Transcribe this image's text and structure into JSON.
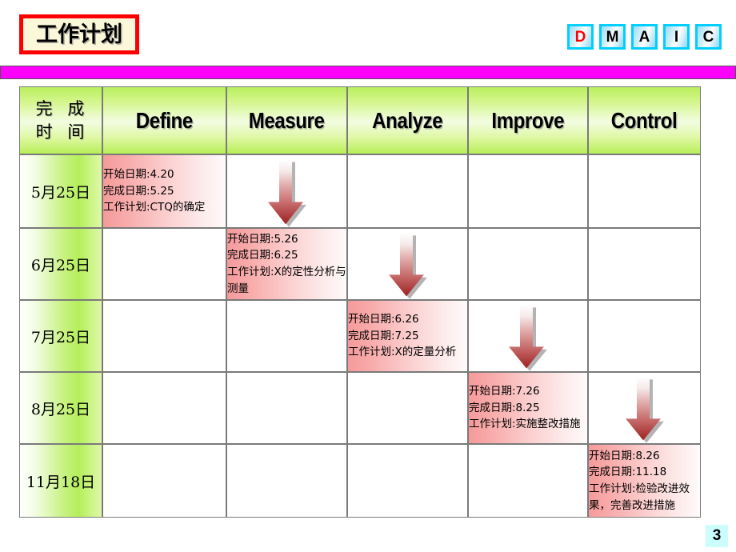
{
  "slide": {
    "title": "工作计划",
    "page_number": "3",
    "accent_red": "#ff0000",
    "divider_color": "#ff00ff",
    "badge_border": "#00cfff",
    "header_green": "#b6ef56",
    "detail_pink": "#f59a9a",
    "page_badge_bg": "#ccfdfd"
  },
  "dmaic": [
    {
      "letter": "D",
      "accent": true
    },
    {
      "letter": "M",
      "accent": false
    },
    {
      "letter": "A",
      "accent": false
    },
    {
      "letter": "I",
      "accent": false
    },
    {
      "letter": "C",
      "accent": false
    }
  ],
  "table": {
    "headers": {
      "date_line1": "完 成",
      "date_line2": "时 间",
      "phases": [
        "Define",
        "Measure",
        "Analyze",
        "Improve",
        "Control"
      ]
    },
    "rows": [
      {
        "date": "5月25日",
        "detail_col": 0,
        "arrow_col": 1,
        "lines": [
          "开始日期:4.20",
          "完成日期:5.25",
          "工作计划:CTQ的确定"
        ]
      },
      {
        "date": "6月25日",
        "detail_col": 1,
        "arrow_col": 2,
        "lines": [
          "开始日期:5.26",
          "完成日期:6.25",
          "工作计划:X的定性分析与测量"
        ]
      },
      {
        "date": "7月25日",
        "detail_col": 2,
        "arrow_col": 3,
        "lines": [
          "开始日期:6.26",
          "完成日期:7.25",
          "工作计划:X的定量分析"
        ]
      },
      {
        "date": "8月25日",
        "detail_col": 3,
        "arrow_col": 4,
        "lines": [
          "开始日期:7.26",
          "完成日期:8.25",
          "工作计划:实施整改措施"
        ]
      },
      {
        "date": "11月18日",
        "detail_col": 4,
        "arrow_col": -1,
        "lines": [
          "开始日期:8.26",
          "完成日期:11.18",
          "工作计划:检验改进效果，完善改进措施"
        ]
      }
    ]
  }
}
